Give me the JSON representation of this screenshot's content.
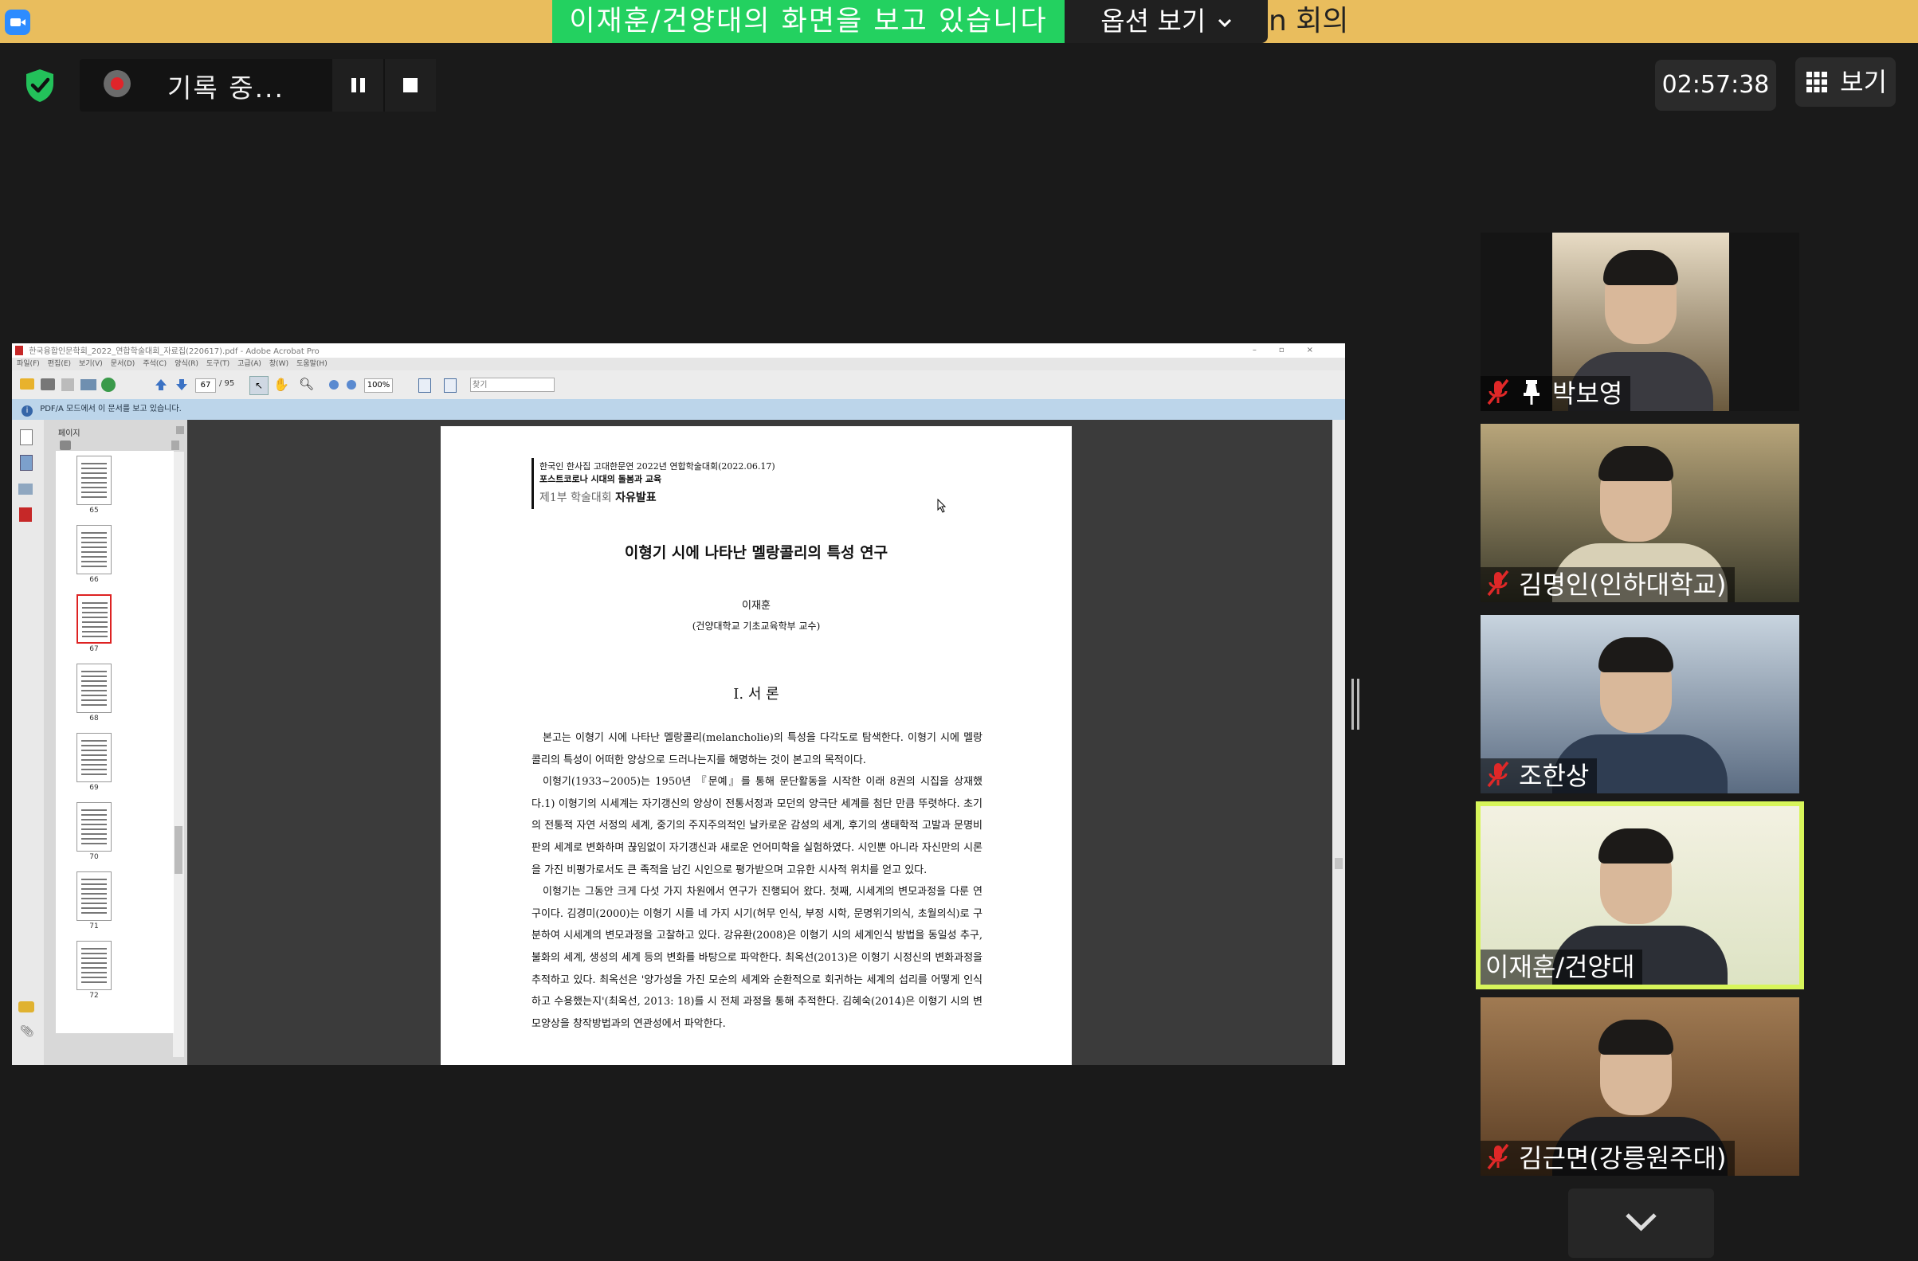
{
  "topbar": {
    "share_banner": "이재훈/건양대의 화면을 보고 있습니다",
    "options_label": "옵션 보기",
    "meeting_title_fragment": "n 회의"
  },
  "toolbar": {
    "recording_label": "기록 중...",
    "timer": "02:57:38",
    "view_label": "보기"
  },
  "acrobat": {
    "title": "한국융합인문학회_2022_연합학술대회_자료집(220617).pdf - Adobe Acrobat Pro",
    "menu": [
      "파일(F)",
      "편집(E)",
      "보기(V)",
      "문서(D)",
      "주석(C)",
      "양식(R)",
      "도구(T)",
      "고급(A)",
      "창(W)",
      "도움말(H)"
    ],
    "page_current": "67",
    "page_total": "/ 95",
    "zoom": "100%",
    "find_placeholder": "찾기",
    "pdfa_message": "PDF/A 모드에서 이 문서를 보고 있습니다.",
    "pages_panel_title": "페이지",
    "thumb_pages": [
      "65",
      "66",
      "67",
      "68",
      "69",
      "70",
      "71",
      "72"
    ],
    "selected_thumb": "67"
  },
  "pdf": {
    "header_line1": "한국인 한사집 고대한문연 2022년 연합학술대회(2022.06.17)",
    "header_line2": "포스트코로나 시대의 돌봄과 교육",
    "header_line3_a": "제1부 학술대회 ",
    "header_line3_b": "자유발표",
    "title": "이형기 시에 나타난 멜랑콜리의 특성 연구",
    "author": "이재훈",
    "affiliation": "(건양대학교 기초교육학부 교수)",
    "section": "Ⅰ. 서 론",
    "paragraphs": [
      "본고는 이형기 시에 나타난 멜랑콜리(melancholie)의 특성을 다각도로 탐색한다. 이형기 시에 멜랑콜리의 특성이 어떠한 양상으로 드러나는지를 해명하는 것이 본고의 목적이다.",
      "이형기(1933~2005)는 1950년 『문예』를 통해 문단활동을 시작한 이래 8권의 시집을 상재했다.1) 이형기의 시세계는 자기갱신의 양상이 전통서정과 모던의 양극단 세계를 첨단 만큼 뚜렷하다. 초기의 전통적 자연 서정의 세계, 중기의 주지주의적인 날카로운 감성의 세계, 후기의 생태학적 고발과 문명비판의 세계로 변화하며 끊임없이 자기갱신과 새로운 언어미학을 실험하였다. 시인뿐 아니라 자신만의 시론을 가진 비평가로서도 큰 족적을 남긴 시인으로 평가받으며 고유한 시사적 위치를 얻고 있다.",
      "이형기는 그동안 크게 다섯 가지 차원에서 연구가 진행되어 왔다. 첫째, 시세계의 변모과정을 다룬 연구이다. 김경미(2000)는 이형기 시를 네 가지 시기(허무 인식, 부정 시학, 문명위기의식, 초월의식)로 구분하여 시세계의 변모과정을 고찰하고 있다. 강유환(2008)은 이형기 시의 세계인식 방법을 동일성 추구, 불화의 세계, 생성의 세계 등의 변화를 바탕으로 파악한다. 최옥선(2013)은 이형기 시정신의 변화과정을 추적하고 있다. 최옥선은 '양가성을 가진 모순의 세계와 순환적으로 회귀하는 세계의 섭리를 어떻게 인식하고 수용했는지'(최옥선, 2013: 18)를 시 전체 과정을 통해 추적한다. 김혜숙(2014)은 이형기 시의 변모양상을 창작방법과의 연관성에서 파악한다."
    ]
  },
  "participants": [
    {
      "name": "박보영",
      "muted": true,
      "pinned": true
    },
    {
      "name": "김명인(인하대학교)",
      "muted": true,
      "pinned": false
    },
    {
      "name": "조한상",
      "muted": true,
      "pinned": false
    },
    {
      "name": "이재훈/건양대",
      "muted": false,
      "pinned": false,
      "speaking": true
    },
    {
      "name": "김근면(강릉원주대)",
      "muted": true,
      "pinned": false
    }
  ],
  "colors": {
    "topbar": "#e9bd5d",
    "share_banner": "#23d160",
    "active_speaker_border": "#d7f55a",
    "mute_red": "#e02828",
    "recording_red": "#e0242a"
  },
  "icons": {
    "security": "shield-check-icon",
    "recording": "record-dot-icon",
    "pause": "pause-icon",
    "stop": "stop-icon",
    "view": "grid-icon",
    "mute": "mic-off-icon",
    "pin": "pin-icon",
    "scroll": "chevron-down-icon"
  }
}
